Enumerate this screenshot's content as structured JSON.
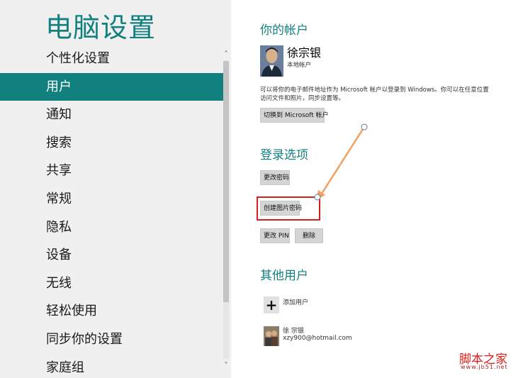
{
  "app": {
    "title": "电脑设置"
  },
  "nav": {
    "items": [
      {
        "label": "个性化设置",
        "selected": false
      },
      {
        "label": "用户",
        "selected": true
      },
      {
        "label": "通知",
        "selected": false
      },
      {
        "label": "搜索",
        "selected": false
      },
      {
        "label": "共享",
        "selected": false
      },
      {
        "label": "常规",
        "selected": false
      },
      {
        "label": "隐私",
        "selected": false
      },
      {
        "label": "设备",
        "selected": false
      },
      {
        "label": "无线",
        "selected": false
      },
      {
        "label": "轻松使用",
        "selected": false
      },
      {
        "label": "同步你的设置",
        "selected": false
      },
      {
        "label": "家庭组",
        "selected": false
      }
    ]
  },
  "account": {
    "title": "你的帐户",
    "user_name": "徐宗银",
    "user_type": "本地帐户",
    "description": "可以将你的电子邮件地址作为 Microsoft 帐户以登录到 Windows。你可以在任意位置访问文件和照片，同步设置等。",
    "switch_button": "切换到 Microsoft 帐户"
  },
  "login": {
    "title": "登录选项",
    "change_password": "更改密码",
    "create_picture_password": "创建图片密码",
    "change_pin": "更改 PIN",
    "delete": "删除"
  },
  "others": {
    "title": "其他用户",
    "add_user": "添加用户",
    "add_user_icon": "+",
    "user_name": "徐 宗银",
    "user_email": "xzy900@hotmail.com"
  },
  "watermark": {
    "title": "脚本之家",
    "url": "www.jb51.net"
  },
  "colors": {
    "accent": "#138080",
    "highlight": "#d21f1f",
    "arrow": "#f0a060"
  }
}
